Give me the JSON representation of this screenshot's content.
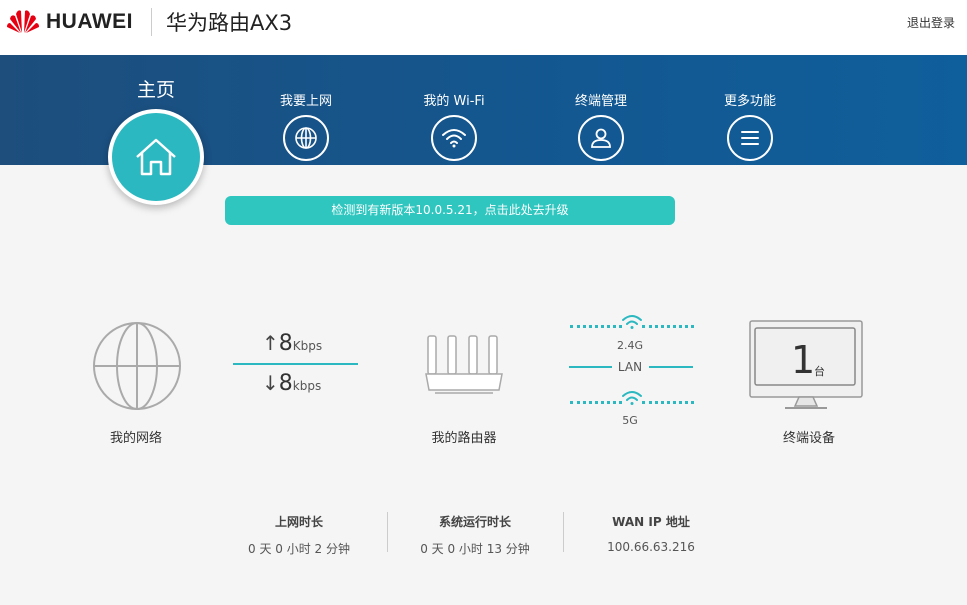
{
  "header": {
    "brand": "HUAWEI",
    "model": "华为路由AX3",
    "logout": "退出登录",
    "logo_color": "#e60012"
  },
  "nav": {
    "home": "主页",
    "items": [
      {
        "label": "我要上网",
        "icon": "globe-icon"
      },
      {
        "label": "我的 Wi-Fi",
        "icon": "wifi-icon"
      },
      {
        "label": "终端管理",
        "icon": "user-icon"
      },
      {
        "label": "更多功能",
        "icon": "menu-icon"
      }
    ],
    "active_color": "#2bb8c0"
  },
  "upgrade_banner": "检测到有新版本10.0.5.21，点击此处去升级",
  "topology": {
    "network_label": "我的网络",
    "upload": {
      "value": "8",
      "unit": "Kbps"
    },
    "download": {
      "value": "8",
      "unit": "kbps"
    },
    "router_label": "我的路由器",
    "band_24": "2.4G",
    "lan": "LAN",
    "band_5": "5G",
    "devices_count": "1",
    "devices_unit": "台",
    "devices_label": "终端设备"
  },
  "stats": [
    {
      "title": "上网时长",
      "value": "0 天 0 小时 2 分钟"
    },
    {
      "title": "系统运行时长",
      "value": "0 天 0 小时 13 分钟"
    },
    {
      "title": "WAN IP 地址",
      "value": "100.66.63.216"
    }
  ]
}
